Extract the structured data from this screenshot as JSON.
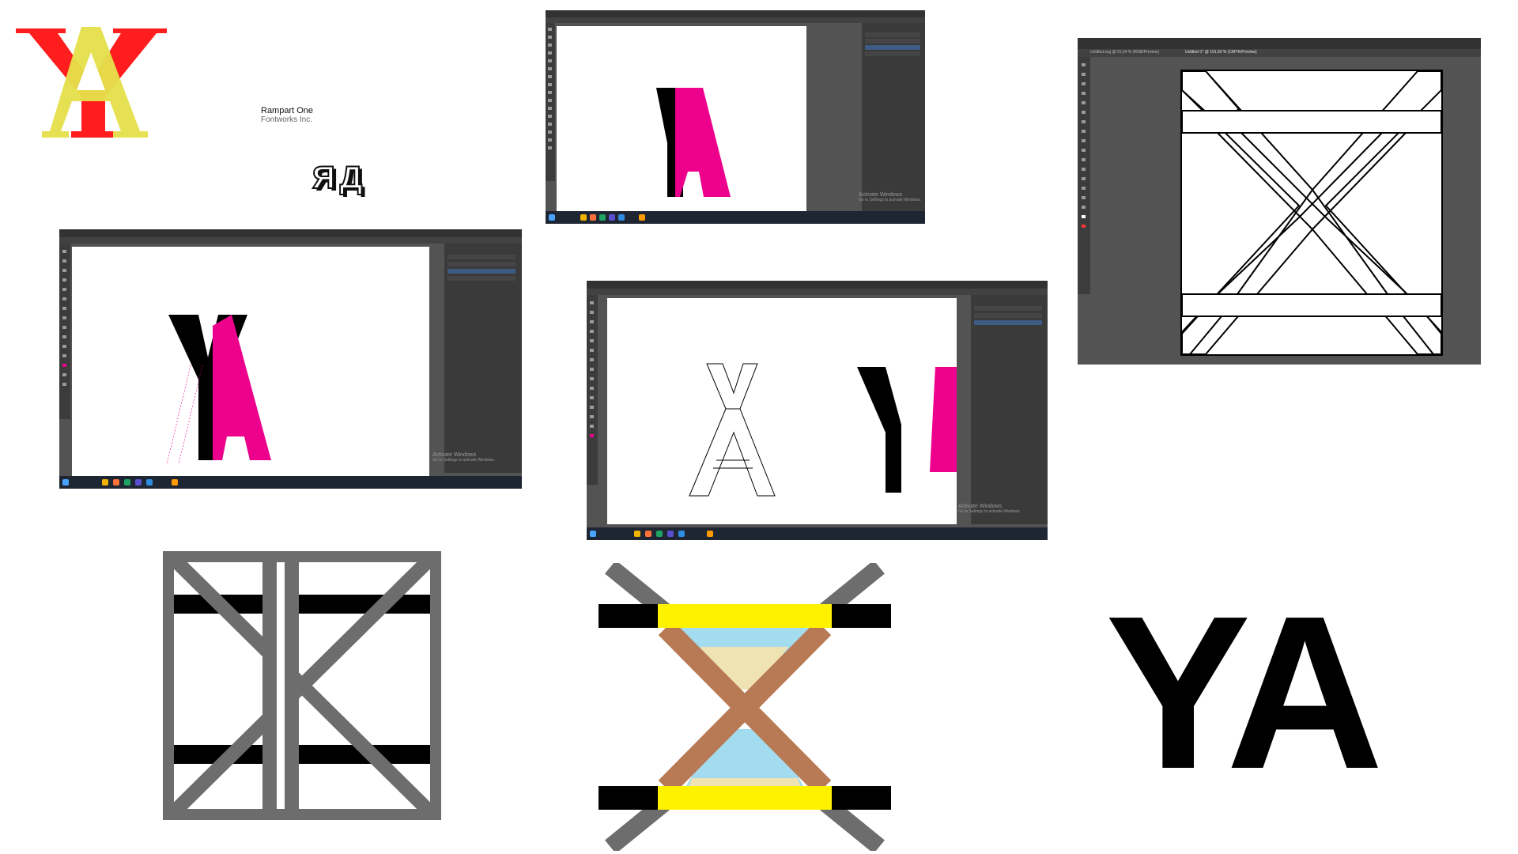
{
  "font_card": {
    "name": "Rampart One",
    "foundry": "Fontworks Inc.",
    "sample": "ЯД"
  },
  "logo_text": "YA",
  "monograms": {
    "red_letter": "Y",
    "yellow_letter": "A"
  },
  "colors": {
    "magenta": "#ec008c",
    "red": "#ff1d1d",
    "yellow": "#e5e04b",
    "gray": "#6d6d6d",
    "brown": "#b87a54",
    "sky": "#a4dcef",
    "sand": "#efe3b3",
    "bright_yellow": "#fff200",
    "ui_dark": "#535353"
  },
  "screenshot_a": {
    "watermark_line1": "Activate Windows",
    "watermark_line2": "Go to Settings to activate Windows."
  },
  "screenshot_b": {
    "watermark_line1": "Activate Windows",
    "watermark_line2": "Go to Settings to activate Windows."
  },
  "screenshot_c": {
    "watermark_line1": "Activate Windows",
    "watermark_line2": "Go to Settings to activate Windows."
  },
  "screenshot_d": {
    "tab1": "Untitled.svg @ 91,04 % (RGB/Preview)",
    "tab2": "Untitled-1* @ 191,99 % (CMYK/Preview)"
  }
}
